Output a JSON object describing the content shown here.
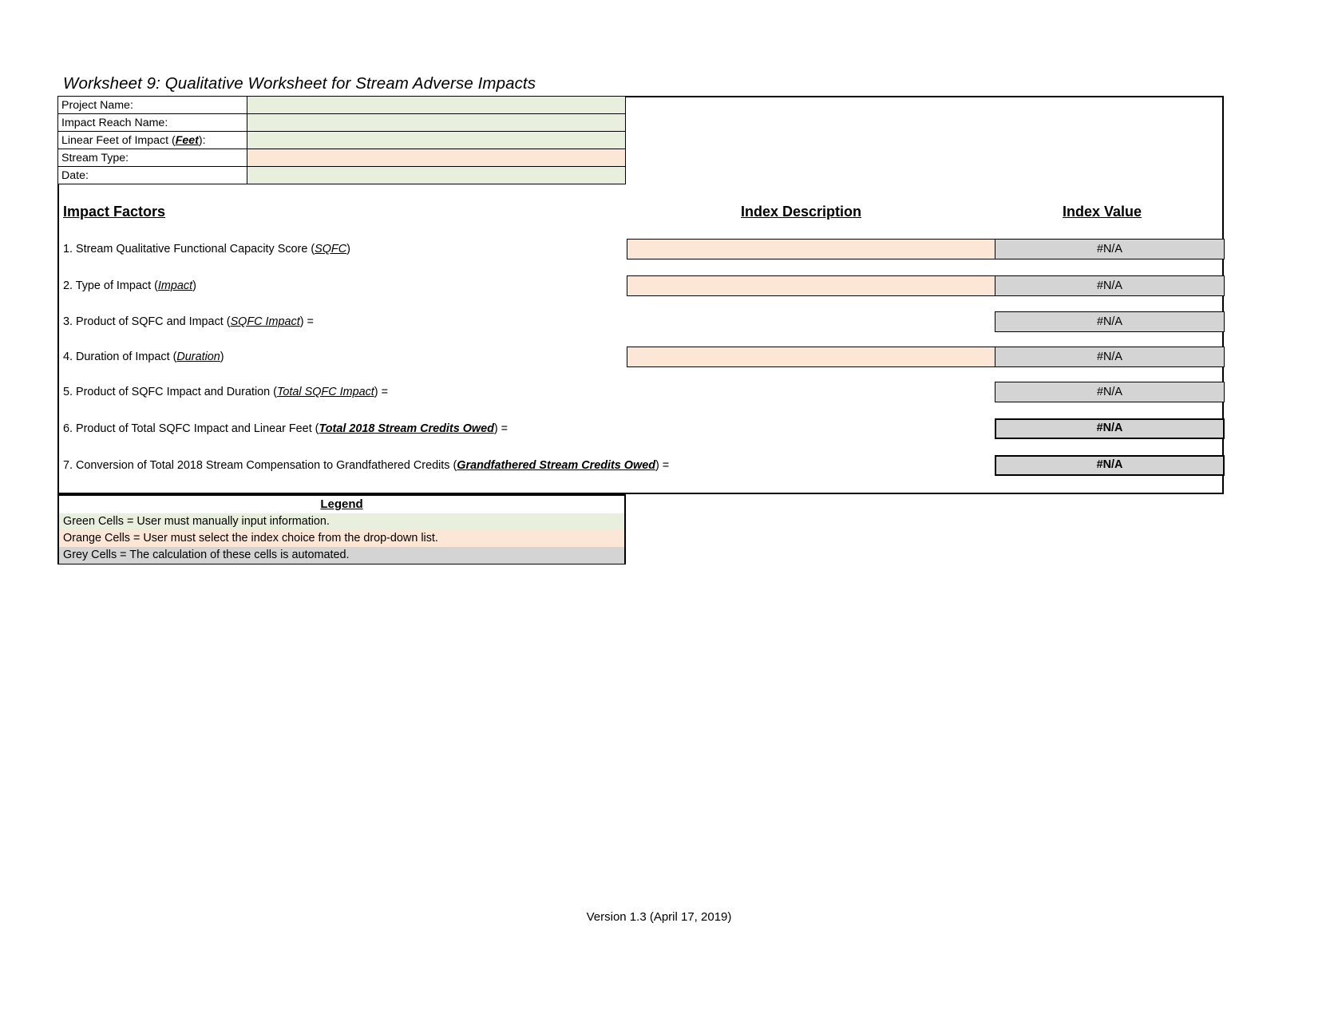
{
  "worksheet": {
    "title": "Worksheet 9:  Qualitative Worksheet for Stream Adverse Impacts"
  },
  "info_table": {
    "rows": [
      {
        "label": "Project Name:",
        "value": "",
        "cell_type": "green"
      },
      {
        "label": "Impact Reach Name:",
        "value": "",
        "cell_type": "green"
      },
      {
        "label_pre": "Linear Feet of Impact (",
        "label_em": "Feet",
        "label_post": "):",
        "value": "",
        "cell_type": "green"
      },
      {
        "label": "Stream Type:",
        "value": "",
        "cell_type": "orange"
      },
      {
        "label": "Date:",
        "value": "",
        "cell_type": "green"
      }
    ]
  },
  "columns": {
    "impact_factors": "Impact Factors",
    "index_description": "Index Description",
    "index_value": "Index Value"
  },
  "factors": [
    {
      "pre": "1. Stream Qualitative Functional Capacity Score (",
      "em": "SQFC",
      "post": ")",
      "has_desc": true,
      "desc_value": "",
      "value": "#N/A",
      "emphasis": false
    },
    {
      "pre": "2. Type of Impact (",
      "em": "Impact",
      "post": ")",
      "has_desc": true,
      "desc_value": "",
      "value": "#N/A",
      "emphasis": false
    },
    {
      "pre": "3. Product of SQFC and Impact (",
      "em": "SQFC Impact",
      "post": ") =",
      "has_desc": false,
      "desc_value": "",
      "value": "#N/A",
      "emphasis": false
    },
    {
      "pre": "4. Duration of Impact (",
      "em": "Duration",
      "post": ")",
      "has_desc": true,
      "desc_value": "",
      "value": "#N/A",
      "emphasis": false
    },
    {
      "pre": "5. Product of SQFC Impact and Duration (",
      "em": "Total SQFC Impact",
      "post": ") =",
      "has_desc": false,
      "desc_value": "",
      "value": "#N/A",
      "emphasis": false
    },
    {
      "pre": "6. Product of Total SQFC Impact and Linear Feet (",
      "em": "Total 2018 Stream Credits Owed",
      "post": ") =",
      "has_desc": false,
      "desc_value": "",
      "value": "#N/A",
      "emphasis": true
    },
    {
      "pre": "7. Conversion of Total 2018 Stream Compensation to Grandfathered Credits (",
      "em": "Grandfathered Stream Credits Owed",
      "post": ") =",
      "has_desc": false,
      "desc_value": "",
      "value": "#N/A",
      "emphasis": true
    }
  ],
  "legend": {
    "title": "Legend",
    "items": [
      {
        "text": "Green Cells = User must manually input information.",
        "cell_type": "green"
      },
      {
        "text": "Orange Cells = User must select the index choice from the drop-down list.",
        "cell_type": "orange"
      },
      {
        "text": "Grey Cells = The calculation of these cells is automated.",
        "cell_type": "grey"
      }
    ]
  },
  "footer": {
    "version": "Version 1.3 (April 17, 2019)"
  },
  "colors": {
    "green_cell": "#e9efdd",
    "orange_cell": "#fce7d7",
    "grey_cell": "#d4d4d4",
    "border": "#000000"
  }
}
